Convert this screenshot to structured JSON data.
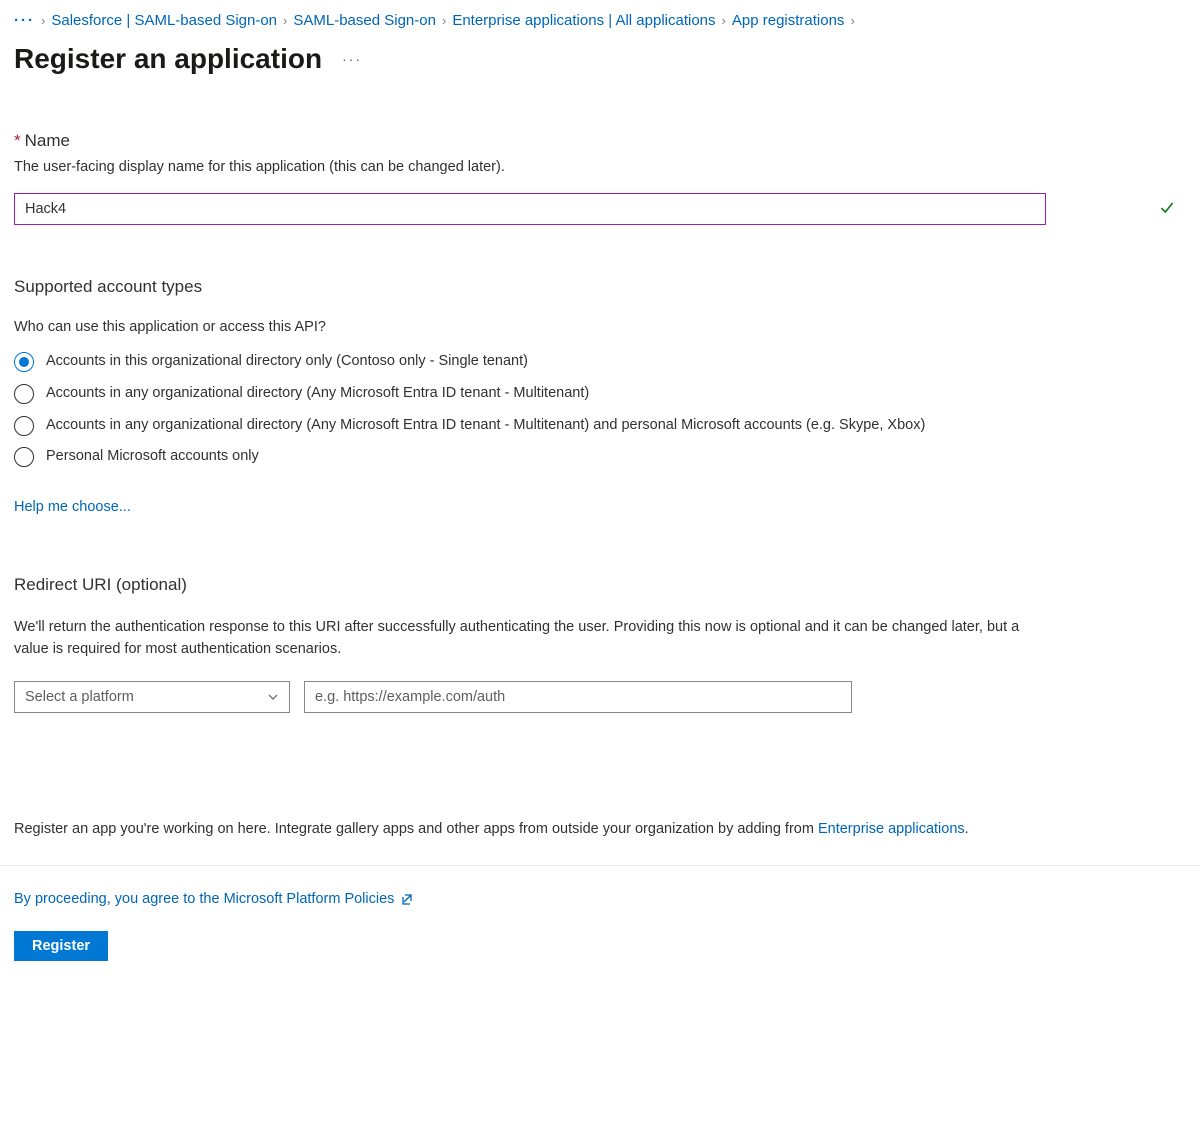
{
  "breadcrumb": {
    "items": [
      "Salesforce | SAML-based Sign-on",
      "SAML-based Sign-on",
      "Enterprise applications | All applications",
      "App registrations"
    ]
  },
  "page_title": "Register an application",
  "name_section": {
    "label": "Name",
    "hint": "The user-facing display name for this application (this can be changed later).",
    "value": "Hack4"
  },
  "account_types": {
    "title": "Supported account types",
    "question": "Who can use this application or access this API?",
    "options": [
      "Accounts in this organizational directory only (Contoso only - Single tenant)",
      "Accounts in any organizational directory (Any Microsoft Entra ID tenant - Multitenant)",
      "Accounts in any organizational directory (Any Microsoft Entra ID tenant - Multitenant) and personal Microsoft accounts (e.g. Skype, Xbox)",
      "Personal Microsoft accounts only"
    ],
    "help_link": "Help me choose..."
  },
  "redirect": {
    "title": "Redirect URI (optional)",
    "description": "We'll return the authentication response to this URI after successfully authenticating the user. Providing this now is optional and it can be changed later, but a value is required for most authentication scenarios.",
    "platform_placeholder": "Select a platform",
    "uri_placeholder": "e.g. https://example.com/auth"
  },
  "footer": {
    "note_prefix": "Register an app you're working on here. Integrate gallery apps and other apps from outside your organization by adding from ",
    "note_link": "Enterprise applications",
    "note_suffix": ".",
    "policies": "By proceeding, you agree to the Microsoft Platform Policies",
    "register_button": "Register"
  }
}
